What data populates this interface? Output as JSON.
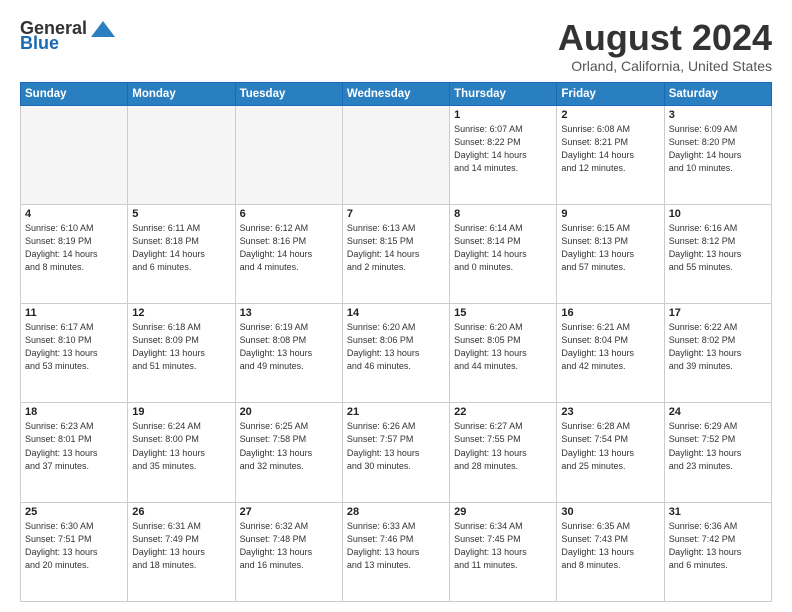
{
  "header": {
    "logo_general": "General",
    "logo_blue": "Blue",
    "month_title": "August 2024",
    "location": "Orland, California, United States"
  },
  "weekdays": [
    "Sunday",
    "Monday",
    "Tuesday",
    "Wednesday",
    "Thursday",
    "Friday",
    "Saturday"
  ],
  "weeks": [
    [
      {
        "day": "",
        "info": ""
      },
      {
        "day": "",
        "info": ""
      },
      {
        "day": "",
        "info": ""
      },
      {
        "day": "",
        "info": ""
      },
      {
        "day": "1",
        "info": "Sunrise: 6:07 AM\nSunset: 8:22 PM\nDaylight: 14 hours\nand 14 minutes."
      },
      {
        "day": "2",
        "info": "Sunrise: 6:08 AM\nSunset: 8:21 PM\nDaylight: 14 hours\nand 12 minutes."
      },
      {
        "day": "3",
        "info": "Sunrise: 6:09 AM\nSunset: 8:20 PM\nDaylight: 14 hours\nand 10 minutes."
      }
    ],
    [
      {
        "day": "4",
        "info": "Sunrise: 6:10 AM\nSunset: 8:19 PM\nDaylight: 14 hours\nand 8 minutes."
      },
      {
        "day": "5",
        "info": "Sunrise: 6:11 AM\nSunset: 8:18 PM\nDaylight: 14 hours\nand 6 minutes."
      },
      {
        "day": "6",
        "info": "Sunrise: 6:12 AM\nSunset: 8:16 PM\nDaylight: 14 hours\nand 4 minutes."
      },
      {
        "day": "7",
        "info": "Sunrise: 6:13 AM\nSunset: 8:15 PM\nDaylight: 14 hours\nand 2 minutes."
      },
      {
        "day": "8",
        "info": "Sunrise: 6:14 AM\nSunset: 8:14 PM\nDaylight: 14 hours\nand 0 minutes."
      },
      {
        "day": "9",
        "info": "Sunrise: 6:15 AM\nSunset: 8:13 PM\nDaylight: 13 hours\nand 57 minutes."
      },
      {
        "day": "10",
        "info": "Sunrise: 6:16 AM\nSunset: 8:12 PM\nDaylight: 13 hours\nand 55 minutes."
      }
    ],
    [
      {
        "day": "11",
        "info": "Sunrise: 6:17 AM\nSunset: 8:10 PM\nDaylight: 13 hours\nand 53 minutes."
      },
      {
        "day": "12",
        "info": "Sunrise: 6:18 AM\nSunset: 8:09 PM\nDaylight: 13 hours\nand 51 minutes."
      },
      {
        "day": "13",
        "info": "Sunrise: 6:19 AM\nSunset: 8:08 PM\nDaylight: 13 hours\nand 49 minutes."
      },
      {
        "day": "14",
        "info": "Sunrise: 6:20 AM\nSunset: 8:06 PM\nDaylight: 13 hours\nand 46 minutes."
      },
      {
        "day": "15",
        "info": "Sunrise: 6:20 AM\nSunset: 8:05 PM\nDaylight: 13 hours\nand 44 minutes."
      },
      {
        "day": "16",
        "info": "Sunrise: 6:21 AM\nSunset: 8:04 PM\nDaylight: 13 hours\nand 42 minutes."
      },
      {
        "day": "17",
        "info": "Sunrise: 6:22 AM\nSunset: 8:02 PM\nDaylight: 13 hours\nand 39 minutes."
      }
    ],
    [
      {
        "day": "18",
        "info": "Sunrise: 6:23 AM\nSunset: 8:01 PM\nDaylight: 13 hours\nand 37 minutes."
      },
      {
        "day": "19",
        "info": "Sunrise: 6:24 AM\nSunset: 8:00 PM\nDaylight: 13 hours\nand 35 minutes."
      },
      {
        "day": "20",
        "info": "Sunrise: 6:25 AM\nSunset: 7:58 PM\nDaylight: 13 hours\nand 32 minutes."
      },
      {
        "day": "21",
        "info": "Sunrise: 6:26 AM\nSunset: 7:57 PM\nDaylight: 13 hours\nand 30 minutes."
      },
      {
        "day": "22",
        "info": "Sunrise: 6:27 AM\nSunset: 7:55 PM\nDaylight: 13 hours\nand 28 minutes."
      },
      {
        "day": "23",
        "info": "Sunrise: 6:28 AM\nSunset: 7:54 PM\nDaylight: 13 hours\nand 25 minutes."
      },
      {
        "day": "24",
        "info": "Sunrise: 6:29 AM\nSunset: 7:52 PM\nDaylight: 13 hours\nand 23 minutes."
      }
    ],
    [
      {
        "day": "25",
        "info": "Sunrise: 6:30 AM\nSunset: 7:51 PM\nDaylight: 13 hours\nand 20 minutes."
      },
      {
        "day": "26",
        "info": "Sunrise: 6:31 AM\nSunset: 7:49 PM\nDaylight: 13 hours\nand 18 minutes."
      },
      {
        "day": "27",
        "info": "Sunrise: 6:32 AM\nSunset: 7:48 PM\nDaylight: 13 hours\nand 16 minutes."
      },
      {
        "day": "28",
        "info": "Sunrise: 6:33 AM\nSunset: 7:46 PM\nDaylight: 13 hours\nand 13 minutes."
      },
      {
        "day": "29",
        "info": "Sunrise: 6:34 AM\nSunset: 7:45 PM\nDaylight: 13 hours\nand 11 minutes."
      },
      {
        "day": "30",
        "info": "Sunrise: 6:35 AM\nSunset: 7:43 PM\nDaylight: 13 hours\nand 8 minutes."
      },
      {
        "day": "31",
        "info": "Sunrise: 6:36 AM\nSunset: 7:42 PM\nDaylight: 13 hours\nand 6 minutes."
      }
    ]
  ]
}
